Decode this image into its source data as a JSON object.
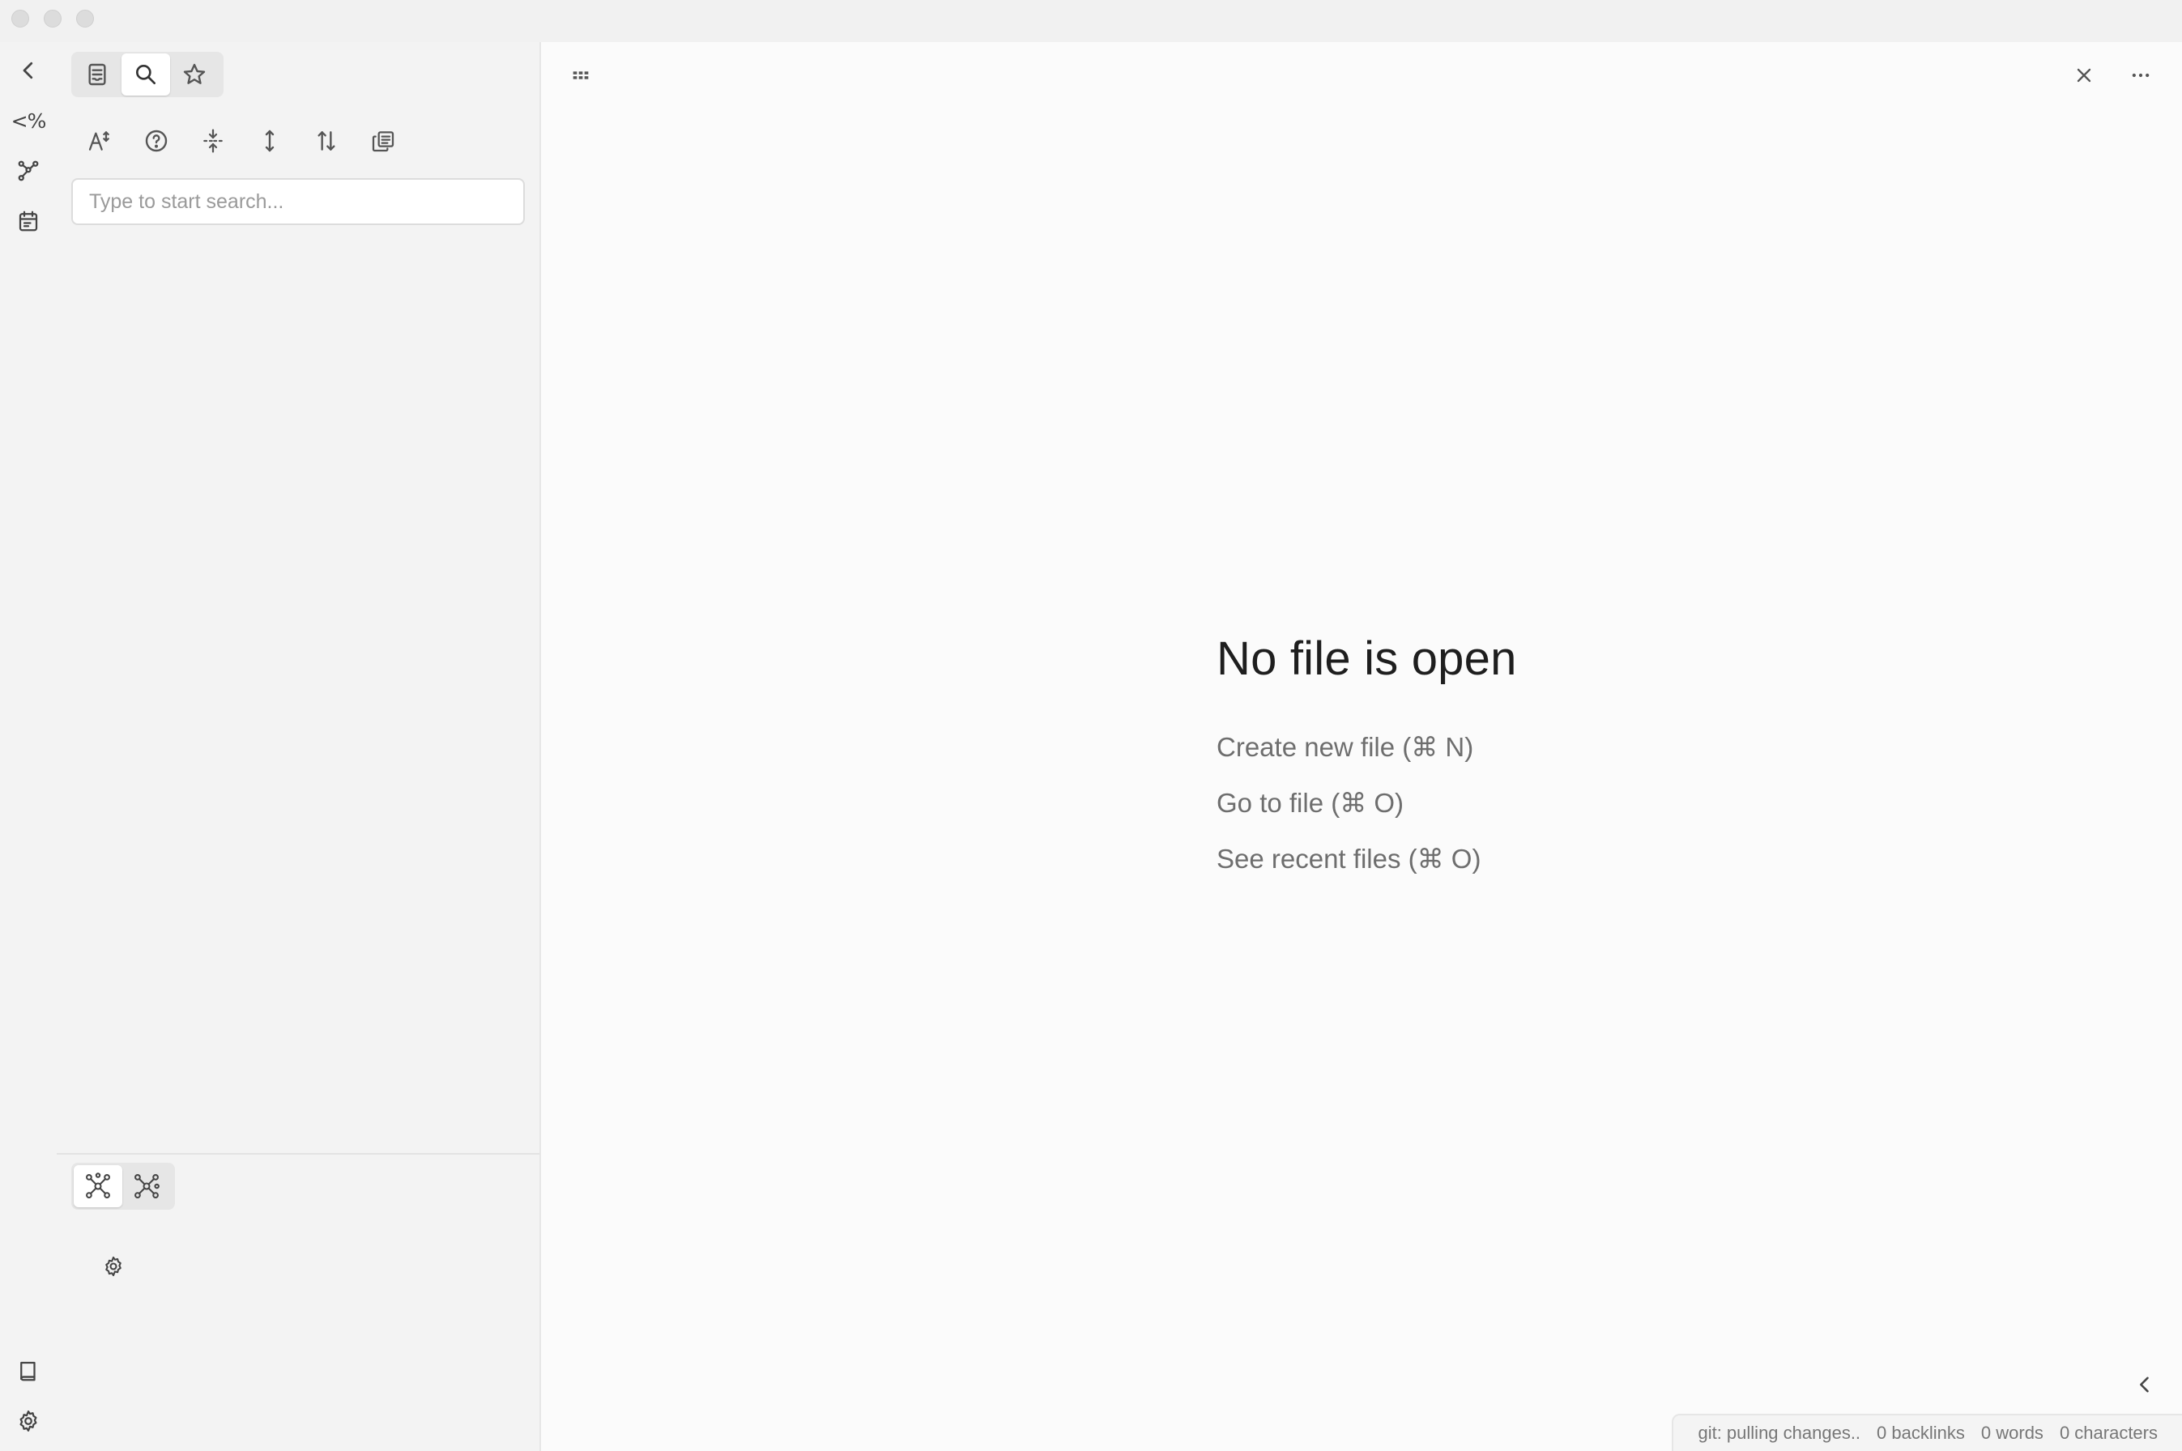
{
  "window": {
    "traffic_lights": [
      "close-light",
      "minimize-light",
      "zoom-light"
    ]
  },
  "ribbon": {
    "top_items": [
      {
        "name": "collapse-sidebar-icon"
      },
      {
        "name": "templater-icon",
        "glyph": "<%"
      },
      {
        "name": "graph-view-icon"
      },
      {
        "name": "daily-note-icon"
      }
    ],
    "bottom_items": [
      {
        "name": "vault-icon"
      },
      {
        "name": "settings-icon"
      }
    ]
  },
  "sidebar": {
    "tabs": [
      {
        "name": "file-explorer-tab",
        "active": false
      },
      {
        "name": "search-tab",
        "active": true
      },
      {
        "name": "bookmarks-tab",
        "active": false
      }
    ],
    "nav_buttons": [
      "match-case-icon",
      "explain-search-icon",
      "collapse-results-icon",
      "show-more-context-icon",
      "sort-icon",
      "copy-results-icon"
    ],
    "search": {
      "placeholder": "Type to start search...",
      "value": ""
    },
    "graph_tabs": [
      {
        "name": "local-graph-tab",
        "active": true
      },
      {
        "name": "global-graph-tab",
        "active": false
      }
    ]
  },
  "main": {
    "empty_state": {
      "title": "No file is open",
      "actions": [
        "Create new file (⌘ N)",
        "Go to file (⌘ O)",
        "See recent files (⌘ O)"
      ]
    },
    "status_bar": {
      "git": "git: pulling changes..",
      "backlinks": "0 backlinks",
      "words": "0 words",
      "characters": "0 characters"
    }
  },
  "colors": {
    "sidebar_bg": "#f3f3f3",
    "main_bg": "#fbfbfb",
    "icon": "#555555",
    "muted_text": "#6e6e6e"
  }
}
